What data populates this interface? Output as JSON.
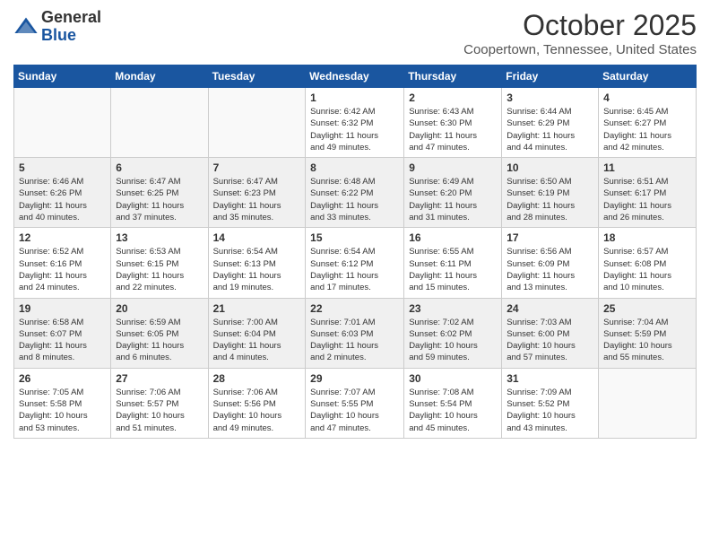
{
  "header": {
    "logo_general": "General",
    "logo_blue": "Blue",
    "month_title": "October 2025",
    "location": "Coopertown, Tennessee, United States"
  },
  "weekdays": [
    "Sunday",
    "Monday",
    "Tuesday",
    "Wednesday",
    "Thursday",
    "Friday",
    "Saturday"
  ],
  "weeks": [
    [
      {
        "day": "",
        "info": ""
      },
      {
        "day": "",
        "info": ""
      },
      {
        "day": "",
        "info": ""
      },
      {
        "day": "1",
        "info": "Sunrise: 6:42 AM\nSunset: 6:32 PM\nDaylight: 11 hours\nand 49 minutes."
      },
      {
        "day": "2",
        "info": "Sunrise: 6:43 AM\nSunset: 6:30 PM\nDaylight: 11 hours\nand 47 minutes."
      },
      {
        "day": "3",
        "info": "Sunrise: 6:44 AM\nSunset: 6:29 PM\nDaylight: 11 hours\nand 44 minutes."
      },
      {
        "day": "4",
        "info": "Sunrise: 6:45 AM\nSunset: 6:27 PM\nDaylight: 11 hours\nand 42 minutes."
      }
    ],
    [
      {
        "day": "5",
        "info": "Sunrise: 6:46 AM\nSunset: 6:26 PM\nDaylight: 11 hours\nand 40 minutes."
      },
      {
        "day": "6",
        "info": "Sunrise: 6:47 AM\nSunset: 6:25 PM\nDaylight: 11 hours\nand 37 minutes."
      },
      {
        "day": "7",
        "info": "Sunrise: 6:47 AM\nSunset: 6:23 PM\nDaylight: 11 hours\nand 35 minutes."
      },
      {
        "day": "8",
        "info": "Sunrise: 6:48 AM\nSunset: 6:22 PM\nDaylight: 11 hours\nand 33 minutes."
      },
      {
        "day": "9",
        "info": "Sunrise: 6:49 AM\nSunset: 6:20 PM\nDaylight: 11 hours\nand 31 minutes."
      },
      {
        "day": "10",
        "info": "Sunrise: 6:50 AM\nSunset: 6:19 PM\nDaylight: 11 hours\nand 28 minutes."
      },
      {
        "day": "11",
        "info": "Sunrise: 6:51 AM\nSunset: 6:17 PM\nDaylight: 11 hours\nand 26 minutes."
      }
    ],
    [
      {
        "day": "12",
        "info": "Sunrise: 6:52 AM\nSunset: 6:16 PM\nDaylight: 11 hours\nand 24 minutes."
      },
      {
        "day": "13",
        "info": "Sunrise: 6:53 AM\nSunset: 6:15 PM\nDaylight: 11 hours\nand 22 minutes."
      },
      {
        "day": "14",
        "info": "Sunrise: 6:54 AM\nSunset: 6:13 PM\nDaylight: 11 hours\nand 19 minutes."
      },
      {
        "day": "15",
        "info": "Sunrise: 6:54 AM\nSunset: 6:12 PM\nDaylight: 11 hours\nand 17 minutes."
      },
      {
        "day": "16",
        "info": "Sunrise: 6:55 AM\nSunset: 6:11 PM\nDaylight: 11 hours\nand 15 minutes."
      },
      {
        "day": "17",
        "info": "Sunrise: 6:56 AM\nSunset: 6:09 PM\nDaylight: 11 hours\nand 13 minutes."
      },
      {
        "day": "18",
        "info": "Sunrise: 6:57 AM\nSunset: 6:08 PM\nDaylight: 11 hours\nand 10 minutes."
      }
    ],
    [
      {
        "day": "19",
        "info": "Sunrise: 6:58 AM\nSunset: 6:07 PM\nDaylight: 11 hours\nand 8 minutes."
      },
      {
        "day": "20",
        "info": "Sunrise: 6:59 AM\nSunset: 6:05 PM\nDaylight: 11 hours\nand 6 minutes."
      },
      {
        "day": "21",
        "info": "Sunrise: 7:00 AM\nSunset: 6:04 PM\nDaylight: 11 hours\nand 4 minutes."
      },
      {
        "day": "22",
        "info": "Sunrise: 7:01 AM\nSunset: 6:03 PM\nDaylight: 11 hours\nand 2 minutes."
      },
      {
        "day": "23",
        "info": "Sunrise: 7:02 AM\nSunset: 6:02 PM\nDaylight: 10 hours\nand 59 minutes."
      },
      {
        "day": "24",
        "info": "Sunrise: 7:03 AM\nSunset: 6:00 PM\nDaylight: 10 hours\nand 57 minutes."
      },
      {
        "day": "25",
        "info": "Sunrise: 7:04 AM\nSunset: 5:59 PM\nDaylight: 10 hours\nand 55 minutes."
      }
    ],
    [
      {
        "day": "26",
        "info": "Sunrise: 7:05 AM\nSunset: 5:58 PM\nDaylight: 10 hours\nand 53 minutes."
      },
      {
        "day": "27",
        "info": "Sunrise: 7:06 AM\nSunset: 5:57 PM\nDaylight: 10 hours\nand 51 minutes."
      },
      {
        "day": "28",
        "info": "Sunrise: 7:06 AM\nSunset: 5:56 PM\nDaylight: 10 hours\nand 49 minutes."
      },
      {
        "day": "29",
        "info": "Sunrise: 7:07 AM\nSunset: 5:55 PM\nDaylight: 10 hours\nand 47 minutes."
      },
      {
        "day": "30",
        "info": "Sunrise: 7:08 AM\nSunset: 5:54 PM\nDaylight: 10 hours\nand 45 minutes."
      },
      {
        "day": "31",
        "info": "Sunrise: 7:09 AM\nSunset: 5:52 PM\nDaylight: 10 hours\nand 43 minutes."
      },
      {
        "day": "",
        "info": ""
      }
    ]
  ]
}
